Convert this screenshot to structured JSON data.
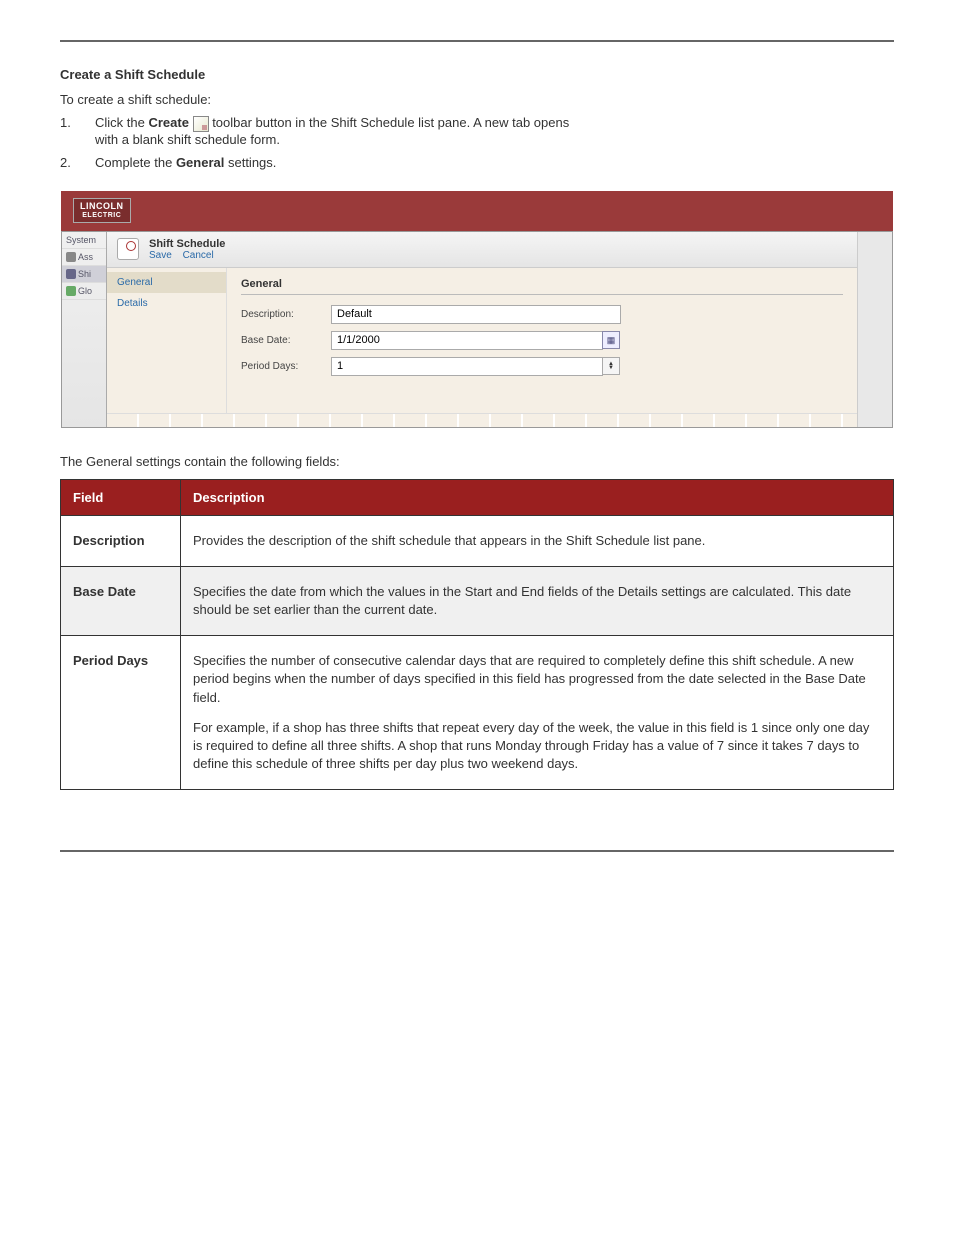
{
  "intro": {
    "line1_bold": "Create a Shift Schedule",
    "line2": "To create a shift schedule:",
    "step1_prefix": "1.",
    "step1_a": "Click the ",
    "step1_b": "Create",
    "step1_c": " toolbar button in the Shift Schedule list pane. A new tab opens",
    "step1_d": "with a blank shift schedule form.",
    "step2_prefix": "2.",
    "step2_a": "Complete the ",
    "step2_b": "General",
    "step2_c": " settings."
  },
  "screenshot": {
    "logo_top": "LINCOLN",
    "logo_bottom": "ELECTRIC",
    "side": {
      "a": "System",
      "b": "Ass",
      "c": "Shi",
      "d": "Glo"
    },
    "title": "Shift Schedule",
    "save": "Save",
    "cancel": "Cancel",
    "tab_general": "General",
    "tab_details": "Details",
    "section_title": "General",
    "lbl_description": "Description:",
    "lbl_basedate": "Base Date:",
    "lbl_perioddays": "Period Days:",
    "val_description": "Default",
    "val_basedate": "1/1/2000",
    "val_perioddays": "1"
  },
  "table": {
    "caption": "The General settings contain the following fields:",
    "hdr_field": "Field",
    "hdr_desc": "Description",
    "row1_f": "Description",
    "row1_d": "Provides the description of the shift schedule that appears in the Shift Schedule list pane.",
    "row2_f": "Base Date",
    "row2_d": "Specifies the date from which the values in the Start and End fields of the Details settings are calculated. This date should be set earlier than the current date.",
    "row3_f": "Period Days",
    "row3_d1": "Specifies the number of consecutive calendar days that are required to completely define this shift schedule. A new period begins when the number of days specified in this field has progressed from the date selected in the Base Date field.",
    "row3_d2": "For example, if a shop has three shifts that repeat every day of the week, the value in this field is 1 since only one day is required to define all three shifts. A shop that runs Monday through Friday has a value of 7 since it takes 7 days to define this schedule of three shifts per day plus two weekend days."
  }
}
